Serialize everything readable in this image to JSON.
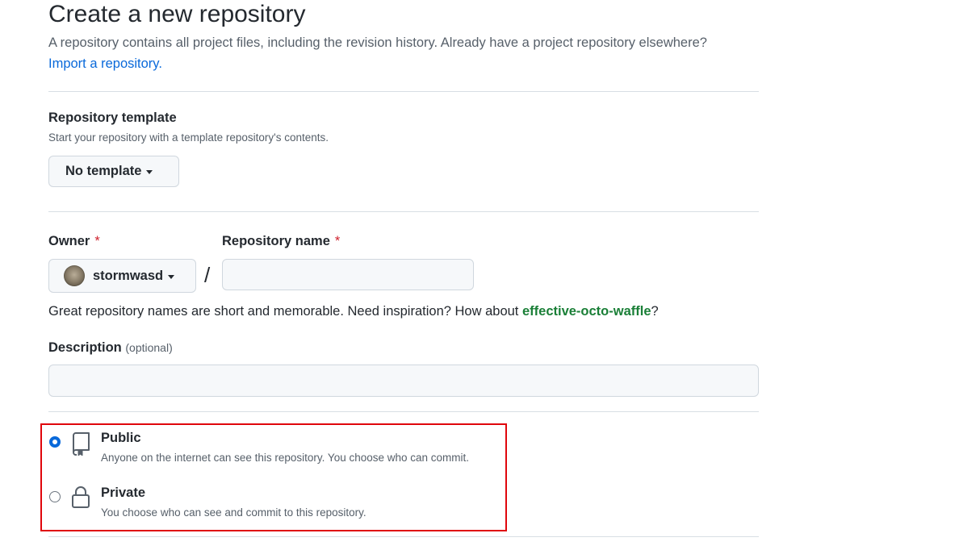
{
  "header": {
    "title": "Create a new repository",
    "lead_text": "A repository contains all project files, including the revision history. Already have a project repository elsewhere?",
    "import_link": "Import a repository."
  },
  "template": {
    "label": "Repository template",
    "note": "Start your repository with a template repository's contents.",
    "button_label": "No template"
  },
  "owner": {
    "label": "Owner",
    "required_mark": "*",
    "value": "stormwasd",
    "separator": "/"
  },
  "repo_name": {
    "label": "Repository name",
    "required_mark": "*",
    "value": ""
  },
  "name_hint": {
    "text": "Great repository names are short and memorable. Need inspiration? How about",
    "suggestion": "effective-octo-waffle",
    "end": "?"
  },
  "description": {
    "label": "Description",
    "optional": "(optional)",
    "value": ""
  },
  "visibility": {
    "options": [
      {
        "title": "Public",
        "desc": "Anyone on the internet can see this repository. You choose who can commit.",
        "icon": "repo-icon",
        "selected": true
      },
      {
        "title": "Private",
        "desc": "You choose who can see and commit to this repository.",
        "icon": "lock-icon",
        "selected": false
      }
    ]
  },
  "colors": {
    "link": "#0969da",
    "suggestion": "#1a7f37",
    "required": "#cf222e",
    "highlight": "#e0060c"
  }
}
